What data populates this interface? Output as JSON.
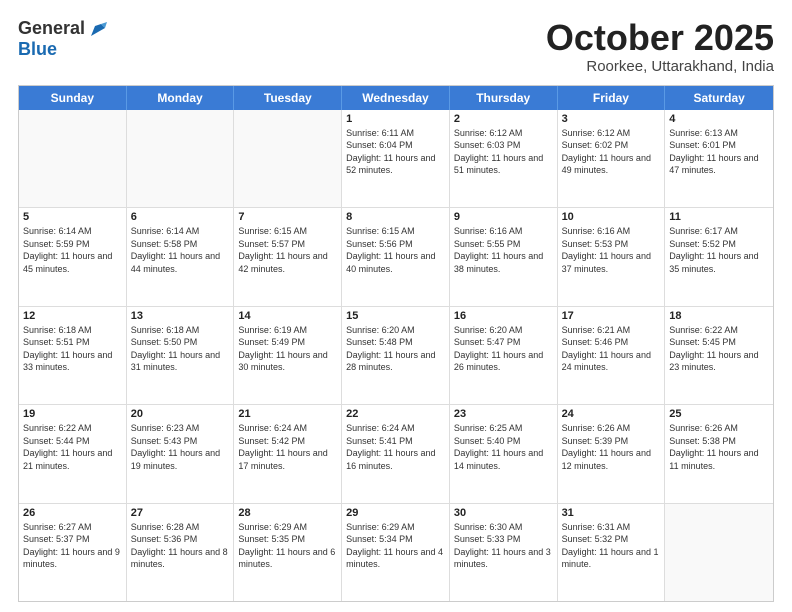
{
  "header": {
    "logo_general": "General",
    "logo_blue": "Blue",
    "month": "October 2025",
    "location": "Roorkee, Uttarakhand, India"
  },
  "days_of_week": [
    "Sunday",
    "Monday",
    "Tuesday",
    "Wednesday",
    "Thursday",
    "Friday",
    "Saturday"
  ],
  "weeks": [
    [
      {
        "day": "",
        "info": ""
      },
      {
        "day": "",
        "info": ""
      },
      {
        "day": "",
        "info": ""
      },
      {
        "day": "1",
        "sunrise": "Sunrise: 6:11 AM",
        "sunset": "Sunset: 6:04 PM",
        "daylight": "Daylight: 11 hours and 52 minutes."
      },
      {
        "day": "2",
        "sunrise": "Sunrise: 6:12 AM",
        "sunset": "Sunset: 6:03 PM",
        "daylight": "Daylight: 11 hours and 51 minutes."
      },
      {
        "day": "3",
        "sunrise": "Sunrise: 6:12 AM",
        "sunset": "Sunset: 6:02 PM",
        "daylight": "Daylight: 11 hours and 49 minutes."
      },
      {
        "day": "4",
        "sunrise": "Sunrise: 6:13 AM",
        "sunset": "Sunset: 6:01 PM",
        "daylight": "Daylight: 11 hours and 47 minutes."
      }
    ],
    [
      {
        "day": "5",
        "sunrise": "Sunrise: 6:14 AM",
        "sunset": "Sunset: 5:59 PM",
        "daylight": "Daylight: 11 hours and 45 minutes."
      },
      {
        "day": "6",
        "sunrise": "Sunrise: 6:14 AM",
        "sunset": "Sunset: 5:58 PM",
        "daylight": "Daylight: 11 hours and 44 minutes."
      },
      {
        "day": "7",
        "sunrise": "Sunrise: 6:15 AM",
        "sunset": "Sunset: 5:57 PM",
        "daylight": "Daylight: 11 hours and 42 minutes."
      },
      {
        "day": "8",
        "sunrise": "Sunrise: 6:15 AM",
        "sunset": "Sunset: 5:56 PM",
        "daylight": "Daylight: 11 hours and 40 minutes."
      },
      {
        "day": "9",
        "sunrise": "Sunrise: 6:16 AM",
        "sunset": "Sunset: 5:55 PM",
        "daylight": "Daylight: 11 hours and 38 minutes."
      },
      {
        "day": "10",
        "sunrise": "Sunrise: 6:16 AM",
        "sunset": "Sunset: 5:53 PM",
        "daylight": "Daylight: 11 hours and 37 minutes."
      },
      {
        "day": "11",
        "sunrise": "Sunrise: 6:17 AM",
        "sunset": "Sunset: 5:52 PM",
        "daylight": "Daylight: 11 hours and 35 minutes."
      }
    ],
    [
      {
        "day": "12",
        "sunrise": "Sunrise: 6:18 AM",
        "sunset": "Sunset: 5:51 PM",
        "daylight": "Daylight: 11 hours and 33 minutes."
      },
      {
        "day": "13",
        "sunrise": "Sunrise: 6:18 AM",
        "sunset": "Sunset: 5:50 PM",
        "daylight": "Daylight: 11 hours and 31 minutes."
      },
      {
        "day": "14",
        "sunrise": "Sunrise: 6:19 AM",
        "sunset": "Sunset: 5:49 PM",
        "daylight": "Daylight: 11 hours and 30 minutes."
      },
      {
        "day": "15",
        "sunrise": "Sunrise: 6:20 AM",
        "sunset": "Sunset: 5:48 PM",
        "daylight": "Daylight: 11 hours and 28 minutes."
      },
      {
        "day": "16",
        "sunrise": "Sunrise: 6:20 AM",
        "sunset": "Sunset: 5:47 PM",
        "daylight": "Daylight: 11 hours and 26 minutes."
      },
      {
        "day": "17",
        "sunrise": "Sunrise: 6:21 AM",
        "sunset": "Sunset: 5:46 PM",
        "daylight": "Daylight: 11 hours and 24 minutes."
      },
      {
        "day": "18",
        "sunrise": "Sunrise: 6:22 AM",
        "sunset": "Sunset: 5:45 PM",
        "daylight": "Daylight: 11 hours and 23 minutes."
      }
    ],
    [
      {
        "day": "19",
        "sunrise": "Sunrise: 6:22 AM",
        "sunset": "Sunset: 5:44 PM",
        "daylight": "Daylight: 11 hours and 21 minutes."
      },
      {
        "day": "20",
        "sunrise": "Sunrise: 6:23 AM",
        "sunset": "Sunset: 5:43 PM",
        "daylight": "Daylight: 11 hours and 19 minutes."
      },
      {
        "day": "21",
        "sunrise": "Sunrise: 6:24 AM",
        "sunset": "Sunset: 5:42 PM",
        "daylight": "Daylight: 11 hours and 17 minutes."
      },
      {
        "day": "22",
        "sunrise": "Sunrise: 6:24 AM",
        "sunset": "Sunset: 5:41 PM",
        "daylight": "Daylight: 11 hours and 16 minutes."
      },
      {
        "day": "23",
        "sunrise": "Sunrise: 6:25 AM",
        "sunset": "Sunset: 5:40 PM",
        "daylight": "Daylight: 11 hours and 14 minutes."
      },
      {
        "day": "24",
        "sunrise": "Sunrise: 6:26 AM",
        "sunset": "Sunset: 5:39 PM",
        "daylight": "Daylight: 11 hours and 12 minutes."
      },
      {
        "day": "25",
        "sunrise": "Sunrise: 6:26 AM",
        "sunset": "Sunset: 5:38 PM",
        "daylight": "Daylight: 11 hours and 11 minutes."
      }
    ],
    [
      {
        "day": "26",
        "sunrise": "Sunrise: 6:27 AM",
        "sunset": "Sunset: 5:37 PM",
        "daylight": "Daylight: 11 hours and 9 minutes."
      },
      {
        "day": "27",
        "sunrise": "Sunrise: 6:28 AM",
        "sunset": "Sunset: 5:36 PM",
        "daylight": "Daylight: 11 hours and 8 minutes."
      },
      {
        "day": "28",
        "sunrise": "Sunrise: 6:29 AM",
        "sunset": "Sunset: 5:35 PM",
        "daylight": "Daylight: 11 hours and 6 minutes."
      },
      {
        "day": "29",
        "sunrise": "Sunrise: 6:29 AM",
        "sunset": "Sunset: 5:34 PM",
        "daylight": "Daylight: 11 hours and 4 minutes."
      },
      {
        "day": "30",
        "sunrise": "Sunrise: 6:30 AM",
        "sunset": "Sunset: 5:33 PM",
        "daylight": "Daylight: 11 hours and 3 minutes."
      },
      {
        "day": "31",
        "sunrise": "Sunrise: 6:31 AM",
        "sunset": "Sunset: 5:32 PM",
        "daylight": "Daylight: 11 hours and 1 minute."
      },
      {
        "day": "",
        "info": ""
      }
    ]
  ]
}
